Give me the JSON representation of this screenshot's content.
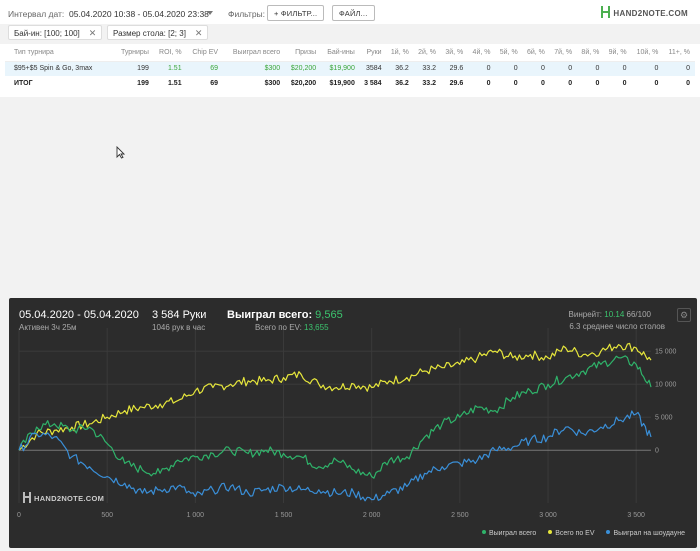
{
  "toolbar": {
    "interval_label": "Интервал дат:",
    "interval_value": "05.04.2020 10:38 - 05.04.2020 23:38",
    "filters_label": "Фильтры:",
    "filter_button": "+ ФИЛЬТР...",
    "file_button": "ФАЙЛ...",
    "logo": "HAND2NOTE.COM"
  },
  "chips": [
    {
      "label": "Бай-ин: [100; 100]"
    },
    {
      "label": "Размер стола: [2; 3]"
    }
  ],
  "table": {
    "headers": [
      "Тип турнира",
      "Турниры",
      "ROI, %",
      "Chip EV",
      "Выиграл всего",
      "Призы",
      "Бай-ины",
      "Руки",
      "1й, %",
      "2й, %",
      "3й, %",
      "4й, %",
      "5й, %",
      "6й, %",
      "7й, %",
      "8й, %",
      "9й, %",
      "10й, %",
      "11+, %"
    ],
    "rows": [
      [
        "$95+$5 Spin & Go, 3max",
        "199",
        "1.51",
        "69",
        "$300",
        "$20,200",
        "$19,900",
        "3584",
        "36.2",
        "33.2",
        "29.6",
        "0",
        "0",
        "0",
        "0",
        "0",
        "0",
        "0",
        "0"
      ],
      [
        "ИТОГ",
        "199",
        "1.51",
        "69",
        "$300",
        "$20,200",
        "$19,900",
        "3 584",
        "36.2",
        "33.2",
        "29.6",
        "0",
        "0",
        "0",
        "0",
        "0",
        "0",
        "0",
        "0"
      ]
    ]
  },
  "panel": {
    "date": "05.04.2020 - 05.04.2020",
    "active": "Активен 3ч 25м",
    "hands": "3 584 Руки",
    "hands_per_hour": "1046 рук в час",
    "won_label": "Выиграл всего:",
    "won_value": "9,565",
    "ev_label": "Всего по EV:",
    "ev_value": "13,655",
    "winrate_label": "Винрейт:",
    "winrate_value": "10.14",
    "winrate_rest": "66/100",
    "avg_tables": "6.3 среднее число столов",
    "watermark": "HAND2NOTE.COM"
  },
  "legend": [
    {
      "name": "Выиграл всего",
      "color": "#2fb36a"
    },
    {
      "name": "Всего по EV",
      "color": "#e6e63c"
    },
    {
      "name": "Выиграл на шоудауне",
      "color": "#3a8fd8"
    }
  ],
  "chart_data": {
    "type": "line",
    "x_ticks": [
      "0",
      "500",
      "1 000",
      "1 500",
      "2 000",
      "2 500",
      "3 000",
      "3 500"
    ],
    "y_ticks": [
      "0",
      "5 000",
      "10 000",
      "15 000"
    ],
    "xlim": [
      0,
      3584
    ],
    "ylim": [
      -8000,
      17000
    ],
    "grid": true,
    "legend_position": "bottom-right",
    "series": [
      {
        "name": "Всего по EV",
        "color": "#e6e63c",
        "x": [
          0,
          100,
          200,
          300,
          400,
          500,
          600,
          700,
          800,
          900,
          1000,
          1100,
          1200,
          1300,
          1400,
          1500,
          1600,
          1700,
          1800,
          1900,
          2000,
          2100,
          2200,
          2300,
          2400,
          2500,
          2600,
          2700,
          2800,
          2900,
          3000,
          3100,
          3200,
          3300,
          3400,
          3500,
          3584
        ],
        "y": [
          0,
          2500,
          3000,
          3500,
          4000,
          5000,
          6000,
          6500,
          7000,
          7500,
          9000,
          9500,
          10000,
          10500,
          10500,
          11000,
          11500,
          10000,
          9500,
          10000,
          9500,
          10500,
          11000,
          12000,
          12500,
          13000,
          14000,
          15000,
          14000,
          14500,
          14000,
          15500,
          14500,
          15000,
          16000,
          15500,
          13655
        ]
      },
      {
        "name": "Выиграл всего",
        "color": "#2fb36a",
        "x": [
          0,
          100,
          200,
          300,
          400,
          500,
          600,
          700,
          800,
          900,
          1000,
          1100,
          1200,
          1300,
          1400,
          1500,
          1600,
          1700,
          1800,
          1900,
          2000,
          2100,
          2200,
          2300,
          2400,
          2500,
          2600,
          2700,
          2800,
          2900,
          3000,
          3100,
          3200,
          3300,
          3400,
          3500,
          3584
        ],
        "y": [
          0,
          3500,
          4000,
          3000,
          3500,
          1000,
          -2000,
          -3000,
          -3500,
          -1500,
          -1000,
          -500,
          0,
          -500,
          0,
          -500,
          -1000,
          -2500,
          -1500,
          -3000,
          -4000,
          -1500,
          -1000,
          2000,
          4000,
          5000,
          6500,
          6000,
          8000,
          9000,
          10000,
          11000,
          12000,
          13000,
          14000,
          13000,
          9565
        ]
      },
      {
        "name": "Выиграл на шоудауне",
        "color": "#3a8fd8",
        "x": [
          0,
          100,
          200,
          300,
          400,
          500,
          600,
          700,
          800,
          900,
          1000,
          1100,
          1200,
          1300,
          1400,
          1500,
          1600,
          1700,
          1800,
          1900,
          2000,
          2100,
          2200,
          2300,
          2400,
          2500,
          2600,
          2700,
          2800,
          2900,
          3000,
          3100,
          3200,
          3300,
          3400,
          3500,
          3584
        ],
        "y": [
          0,
          2500,
          2000,
          -1000,
          -2500,
          -4000,
          -5000,
          -6500,
          -6000,
          -5500,
          -7000,
          -6000,
          -5500,
          -6500,
          -6000,
          -5500,
          -6000,
          -6000,
          -6500,
          -6500,
          -7500,
          -6500,
          -5500,
          -3500,
          -2500,
          -2000,
          -1500,
          0,
          500,
          1500,
          2000,
          3500,
          2500,
          3500,
          4500,
          5500,
          2000
        ]
      }
    ]
  }
}
